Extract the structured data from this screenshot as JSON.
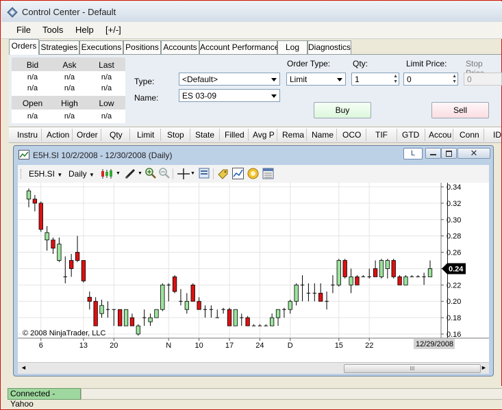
{
  "app": {
    "title": "Control Center - Default"
  },
  "menu": [
    "File",
    "Tools",
    "Help",
    "[+/-]"
  ],
  "tabs": [
    "Orders",
    "Strategies",
    "Executions",
    "Positions",
    "Accounts",
    "Account Performance",
    "Log",
    "Diagnostics"
  ],
  "quote": {
    "headers1": [
      "Bid",
      "Ask",
      "Last"
    ],
    "row1": [
      "n/a",
      "n/a",
      "n/a"
    ],
    "row2": [
      "n/a",
      "n/a",
      "n/a"
    ],
    "headers2": [
      "Open",
      "High",
      "Low"
    ],
    "row3": [
      "n/a",
      "n/a",
      "n/a"
    ]
  },
  "order": {
    "type_label": "Type:",
    "type_value": "<Default>",
    "name_label": "Name:",
    "name_value": "ES 03-09",
    "order_type_label": "Order Type:",
    "order_type_value": "Limit",
    "qty_label": "Qty:",
    "qty_value": "1",
    "limit_label": "Limit Price:",
    "limit_value": "0",
    "stop_label": "Stop Price",
    "stop_value": "0",
    "buy": "Buy",
    "sell": "Sell"
  },
  "columns": [
    "Instru",
    "Action",
    "Order",
    "Qty",
    "Limit",
    "Stop",
    "State",
    "Filled",
    "Avg P",
    "Rema",
    "Name",
    "OCO",
    "TIF",
    "GTD",
    "Accou",
    "Conn",
    "ID"
  ],
  "chart_window": {
    "title": "E5H.SI  10/2/2008 - 12/30/2008 (Daily)",
    "link_button": "L",
    "instrument": "E5H.SI",
    "period": "Daily",
    "copyright": "© 2008 NinjaTrader, LLC",
    "cursor_date": "12/29/2008",
    "last_price_label": "0.24",
    "scroll_grip": "III"
  },
  "chart_data": {
    "type": "candlestick",
    "x_tick_labels": [
      "6",
      "13",
      "20",
      "N",
      "10",
      "17",
      "24",
      "D",
      "15",
      "22"
    ],
    "y_ticks": [
      "0.34",
      "0.32",
      "0.30",
      "0.28",
      "0.26",
      "0.24",
      "0.22",
      "0.20",
      "0.18",
      "0.16"
    ],
    "ylim": [
      0.155,
      0.345
    ],
    "grid": true,
    "colors": {
      "up": "#9de39d",
      "down": "#dd1111",
      "flat": "#000000"
    },
    "candles": [
      {
        "o": 0.325,
        "h": 0.338,
        "l": 0.315,
        "c": 0.335
      },
      {
        "o": 0.325,
        "h": 0.33,
        "l": 0.31,
        "c": 0.32
      },
      {
        "o": 0.32,
        "h": 0.322,
        "l": 0.285,
        "c": 0.288
      },
      {
        "o": 0.275,
        "h": 0.292,
        "l": 0.262,
        "c": 0.284
      },
      {
        "o": 0.275,
        "h": 0.278,
        "l": 0.258,
        "c": 0.265
      },
      {
        "o": 0.25,
        "h": 0.278,
        "l": 0.248,
        "c": 0.27
      },
      {
        "o": 0.23,
        "h": 0.255,
        "l": 0.222,
        "c": 0.23
      },
      {
        "o": 0.25,
        "h": 0.258,
        "l": 0.23,
        "c": 0.24
      },
      {
        "o": 0.26,
        "h": 0.28,
        "l": 0.248,
        "c": 0.25
      },
      {
        "o": 0.25,
        "h": 0.25,
        "l": 0.223,
        "c": 0.225
      },
      {
        "o": 0.205,
        "h": 0.212,
        "l": 0.19,
        "c": 0.2
      },
      {
        "o": 0.2,
        "h": 0.205,
        "l": 0.17,
        "c": 0.17
      },
      {
        "o": 0.185,
        "h": 0.202,
        "l": 0.18,
        "c": 0.195
      },
      {
        "o": 0.19,
        "h": 0.2,
        "l": 0.18,
        "c": 0.19
      },
      {
        "o": 0.19,
        "h": 0.19,
        "l": 0.17,
        "c": 0.19
      },
      {
        "o": 0.19,
        "h": 0.19,
        "l": 0.17,
        "c": 0.17
      },
      {
        "o": 0.17,
        "h": 0.19,
        "l": 0.17,
        "c": 0.19
      },
      {
        "o": 0.18,
        "h": 0.185,
        "l": 0.17,
        "c": 0.17
      },
      {
        "o": 0.16,
        "h": 0.172,
        "l": 0.158,
        "c": 0.17
      },
      {
        "o": 0.18,
        "h": 0.19,
        "l": 0.17,
        "c": 0.18
      },
      {
        "o": 0.175,
        "h": 0.185,
        "l": 0.17,
        "c": 0.18
      },
      {
        "o": 0.18,
        "h": 0.19,
        "l": 0.18,
        "c": 0.19
      },
      {
        "o": 0.19,
        "h": 0.222,
        "l": 0.188,
        "c": 0.22
      },
      {
        "o": 0.22,
        "h": 0.222,
        "l": 0.2,
        "c": 0.22
      },
      {
        "o": 0.23,
        "h": 0.232,
        "l": 0.21,
        "c": 0.212
      },
      {
        "o": 0.2,
        "h": 0.215,
        "l": 0.195,
        "c": 0.2
      },
      {
        "o": 0.19,
        "h": 0.21,
        "l": 0.185,
        "c": 0.2
      },
      {
        "o": 0.22,
        "h": 0.222,
        "l": 0.2,
        "c": 0.2
      },
      {
        "o": 0.2,
        "h": 0.205,
        "l": 0.19,
        "c": 0.19
      },
      {
        "o": 0.19,
        "h": 0.195,
        "l": 0.18,
        "c": 0.19
      },
      {
        "o": 0.19,
        "h": 0.195,
        "l": 0.18,
        "c": 0.19
      },
      {
        "o": 0.18,
        "h": 0.19,
        "l": 0.18,
        "c": 0.18
      },
      {
        "o": 0.19,
        "h": 0.192,
        "l": 0.185,
        "c": 0.19
      },
      {
        "o": 0.19,
        "h": 0.192,
        "l": 0.17,
        "c": 0.17
      },
      {
        "o": 0.17,
        "h": 0.19,
        "l": 0.17,
        "c": 0.19
      },
      {
        "o": 0.18,
        "h": 0.185,
        "l": 0.17,
        "c": 0.18
      },
      {
        "o": 0.18,
        "h": 0.182,
        "l": 0.17,
        "c": 0.17
      },
      {
        "o": 0.17,
        "h": 0.172,
        "l": 0.17,
        "c": 0.17
      },
      {
        "o": 0.17,
        "h": 0.172,
        "l": 0.17,
        "c": 0.17
      },
      {
        "o": 0.17,
        "h": 0.172,
        "l": 0.17,
        "c": 0.17
      },
      {
        "o": 0.17,
        "h": 0.185,
        "l": 0.17,
        "c": 0.18
      },
      {
        "o": 0.18,
        "h": 0.19,
        "l": 0.17,
        "c": 0.19
      },
      {
        "o": 0.19,
        "h": 0.192,
        "l": 0.18,
        "c": 0.19
      },
      {
        "o": 0.19,
        "h": 0.202,
        "l": 0.185,
        "c": 0.2
      },
      {
        "o": 0.2,
        "h": 0.222,
        "l": 0.195,
        "c": 0.22
      },
      {
        "o": 0.22,
        "h": 0.232,
        "l": 0.2,
        "c": 0.22
      },
      {
        "o": 0.21,
        "h": 0.222,
        "l": 0.2,
        "c": 0.21
      },
      {
        "o": 0.21,
        "h": 0.222,
        "l": 0.2,
        "c": 0.21
      },
      {
        "o": 0.21,
        "h": 0.222,
        "l": 0.2,
        "c": 0.2
      },
      {
        "o": 0.2,
        "h": 0.212,
        "l": 0.19,
        "c": 0.2
      },
      {
        "o": 0.22,
        "h": 0.232,
        "l": 0.21,
        "c": 0.22
      },
      {
        "o": 0.22,
        "h": 0.252,
        "l": 0.218,
        "c": 0.25
      },
      {
        "o": 0.25,
        "h": 0.252,
        "l": 0.228,
        "c": 0.23
      },
      {
        "o": 0.22,
        "h": 0.24,
        "l": 0.21,
        "c": 0.23
      },
      {
        "o": 0.23,
        "h": 0.232,
        "l": 0.22,
        "c": 0.22
      },
      {
        "o": 0.23,
        "h": 0.232,
        "l": 0.23,
        "c": 0.23
      },
      {
        "o": 0.23,
        "h": 0.24,
        "l": 0.228,
        "c": 0.23
      },
      {
        "o": 0.24,
        "h": 0.25,
        "l": 0.23,
        "c": 0.23
      },
      {
        "o": 0.23,
        "h": 0.252,
        "l": 0.228,
        "c": 0.25
      },
      {
        "o": 0.24,
        "h": 0.252,
        "l": 0.228,
        "c": 0.25
      },
      {
        "o": 0.25,
        "h": 0.252,
        "l": 0.228,
        "c": 0.23
      },
      {
        "o": 0.23,
        "h": 0.232,
        "l": 0.22,
        "c": 0.22
      },
      {
        "o": 0.22,
        "h": 0.232,
        "l": 0.22,
        "c": 0.23
      },
      {
        "o": 0.23,
        "h": 0.232,
        "l": 0.23,
        "c": 0.23
      },
      {
        "o": 0.23,
        "h": 0.232,
        "l": 0.23,
        "c": 0.23
      },
      {
        "o": 0.23,
        "h": 0.235,
        "l": 0.22,
        "c": 0.23
      },
      {
        "o": 0.23,
        "h": 0.25,
        "l": 0.23,
        "c": 0.24
      }
    ]
  },
  "status": {
    "connection": "Connected - Yahoo"
  }
}
